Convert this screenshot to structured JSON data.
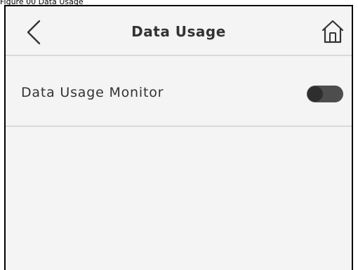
{
  "caption": "Figure 00 Data Usage",
  "header": {
    "title": "Data Usage",
    "back_icon": "chevron-left-icon",
    "home_icon": "home-icon"
  },
  "settings": {
    "data_usage_monitor": {
      "label": "Data Usage Monitor",
      "enabled": false
    }
  },
  "colors": {
    "background": "#f4f4f4",
    "divider": "#d9d9d9",
    "text": "#333333",
    "toggle_track": "#4d4d4d",
    "toggle_knob": "#2e2e2e"
  }
}
